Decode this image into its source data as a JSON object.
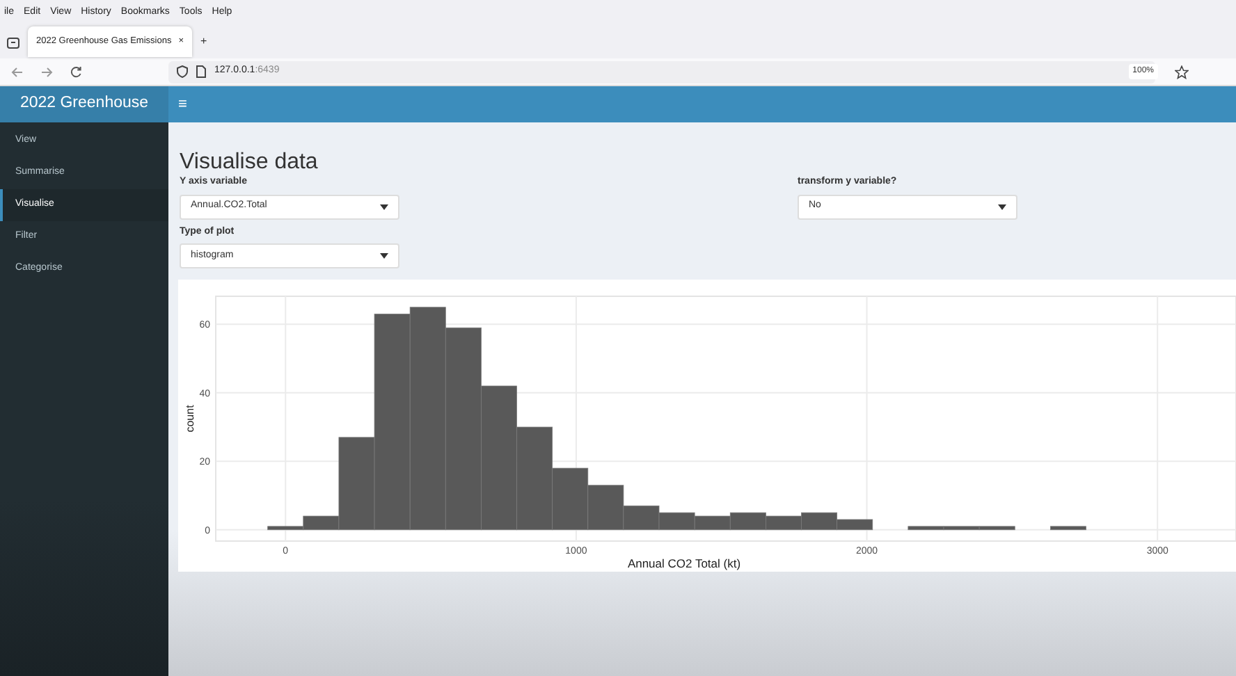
{
  "browser": {
    "menu": [
      "ile",
      "Edit",
      "View",
      "History",
      "Bookmarks",
      "Tools",
      "Help"
    ],
    "tab": {
      "title": "2022 Greenhouse Gas Emissions",
      "close": "×"
    },
    "new_tab": "+",
    "address": {
      "host": "127.0.0.1",
      "port": ":6439"
    },
    "zoom": "100%"
  },
  "app": {
    "brand": "2022 Greenhouse",
    "menu_toggle": "≡"
  },
  "sidebar": {
    "items": [
      {
        "label": "View",
        "selected": false
      },
      {
        "label": "Summarise",
        "selected": false
      },
      {
        "label": "Visualise",
        "selected": true
      },
      {
        "label": "Filter",
        "selected": false
      },
      {
        "label": "Categorise",
        "selected": false
      }
    ]
  },
  "page": {
    "title": "Visualise data",
    "control_columns": [
      {
        "controls": [
          {
            "label": "Y axis variable",
            "value": "Annual.CO2.Total"
          },
          {
            "label": "Type of plot",
            "value": "histogram"
          }
        ]
      },
      {
        "controls": [
          {
            "label": "transform y variable?",
            "value": "No"
          }
        ]
      }
    ],
    "plot": {
      "chart_data": {
        "type": "bar",
        "xlabel": "Annual CO2 Total (kt)",
        "ylabel": "count",
        "x": [
          0,
          122.4,
          244.8,
          367.2,
          489.6,
          612,
          734.4,
          856.8,
          979.2,
          1101.6,
          1224,
          1346.4,
          1468.8,
          1591.2,
          1713.6,
          1836,
          1958.4,
          2080.8,
          2203.2,
          2325.6,
          2448,
          2570.4,
          2692.8
        ],
        "values": [
          1,
          4,
          27,
          63,
          65,
          59,
          42,
          30,
          18,
          13,
          7,
          5,
          4,
          5,
          4,
          5,
          3,
          0,
          1,
          1,
          1,
          0,
          1
        ],
        "xlim": [
          -240,
          3270
        ],
        "ylim": [
          -3.3,
          68.2
        ],
        "xticks": [
          0,
          1000,
          2000,
          3000
        ],
        "yticks": [
          0,
          20,
          40,
          60
        ],
        "grid": true
      }
    }
  }
}
